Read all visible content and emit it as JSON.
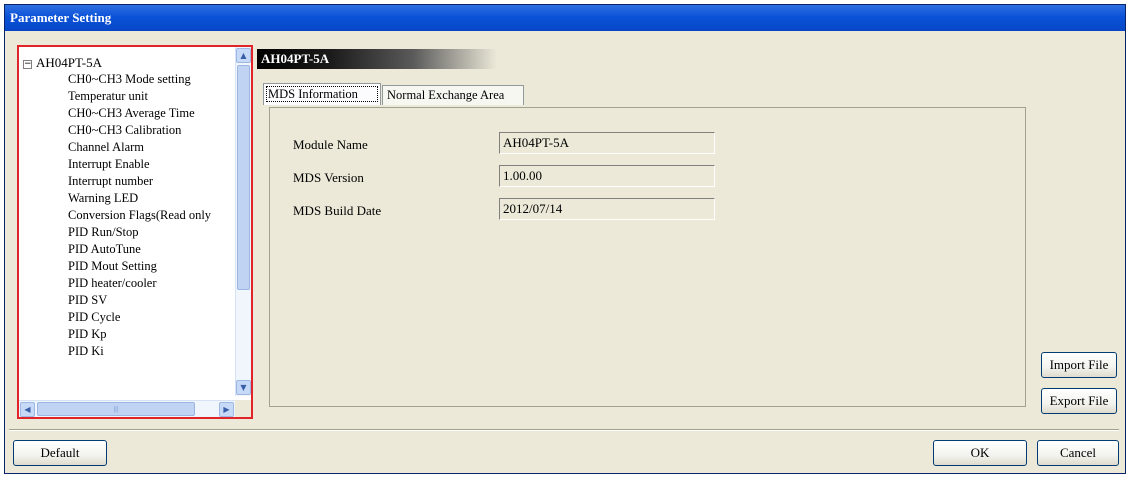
{
  "window": {
    "title": "Parameter Setting"
  },
  "tree": {
    "root_label": "AH04PT-5A",
    "root_expander": "−",
    "items": [
      "CH0~CH3 Mode setting",
      "Temperatur unit",
      "CH0~CH3 Average Time",
      "CH0~CH3 Calibration",
      "Channel Alarm",
      "Interrupt Enable",
      "Interrupt number",
      "Warning LED",
      "Conversion Flags(Read only",
      "PID Run/Stop",
      "PID AutoTune",
      "PID Mout Setting",
      "PID heater/cooler",
      "PID SV",
      "PID Cycle",
      "PID Kp",
      "PID Ki"
    ]
  },
  "module_header": "AH04PT-5A",
  "tabs": [
    {
      "label": "MDS Information",
      "active": true
    },
    {
      "label": "Normal Exchange Area",
      "active": false
    }
  ],
  "fields": [
    {
      "label": "Module Name",
      "value": "AH04PT-5A"
    },
    {
      "label": "MDS Version",
      "value": "1.00.00"
    },
    {
      "label": "MDS Build Date",
      "value": "2012/07/14"
    }
  ],
  "buttons": {
    "import": "Import File",
    "export": "Export File",
    "default": "Default",
    "ok": "OK",
    "cancel": "Cancel"
  },
  "colors": {
    "title_bar": "#0a52d9",
    "highlight_border": "#e0242a",
    "dialog_background": "#ece9d8"
  }
}
